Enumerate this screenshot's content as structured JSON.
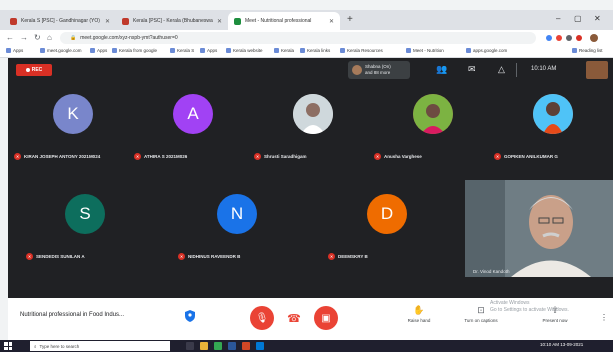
{
  "browser": {
    "tabs": [
      {
        "label": "Kerala S [PSC] - Gandhinagar (YO)",
        "favicon_color": "#c0392b"
      },
      {
        "label": "Kerala [PSC] - Kerala (Bhubaneswar)",
        "favicon_color": "#c0392b"
      },
      {
        "label": "Meet - Nutritional professional",
        "favicon_color": "#1e8e3e"
      }
    ],
    "new_tab": "+",
    "url": "meet.google.com/xyz-nspb-ymt?authuser=0",
    "bookmarks": [
      "Apps",
      "meet.google.com",
      "Apps",
      "Kerala from google",
      "Kerala S",
      "Apps",
      "Kerala website",
      "Kerala",
      "Kerala links",
      "Kerala Resources",
      "Meet - Nutrition",
      "apps.google.com",
      "Reading list"
    ]
  },
  "meet": {
    "rec_label": "REC",
    "presenter_text": [
      "Shabna (On)",
      "and 88 more"
    ],
    "clock": "10:10 AM",
    "participants": [
      {
        "initial": "K",
        "name": "KIRAN JOSEPH ANTONY 2021M024",
        "color": "#7986cb",
        "photo": false
      },
      {
        "initial": "A",
        "name": "ATHIRA S 2021M026",
        "color": "#a142f4",
        "photo": false
      },
      {
        "initial": "",
        "name": "Shrusti Saradhigam",
        "color": "#e0e0e0",
        "photo": true
      },
      {
        "initial": "",
        "name": "Anusha Varghese",
        "color": "#c2185b",
        "photo": true
      },
      {
        "initial": "",
        "name": "GOPIKEN ANILKUMAR G",
        "color": "#d88a6c",
        "photo": true
      },
      {
        "initial": "S",
        "name": "SENDEDIS SUNILAN A",
        "color": "#0d6e5d",
        "photo": false
      },
      {
        "initial": "N",
        "name": "NIDHINUS RAVEENDR B",
        "color": "#1a73e8",
        "photo": false
      },
      {
        "initial": "D",
        "name": "DEEMSKRY B",
        "color": "#ef6c00",
        "photo": false
      }
    ],
    "video_name": "Dr. Vinod Kandoth"
  },
  "controls": {
    "meeting_title": "Nutritional professional in Food Indus...",
    "actions": [
      {
        "icon": "raise-hand-icon",
        "glyph": "✋",
        "label": "Raise hand"
      },
      {
        "icon": "captions-icon",
        "glyph": "⊡",
        "label": "Turn on captions"
      },
      {
        "icon": "present-icon",
        "glyph": "⇪",
        "label": "Present now"
      }
    ],
    "watermark": [
      "Activate Windows",
      "Go to Settings to activate Windows."
    ]
  },
  "taskbar": {
    "search_placeholder": "Type here to search",
    "time": "10:10 AM  13-09-2021"
  }
}
